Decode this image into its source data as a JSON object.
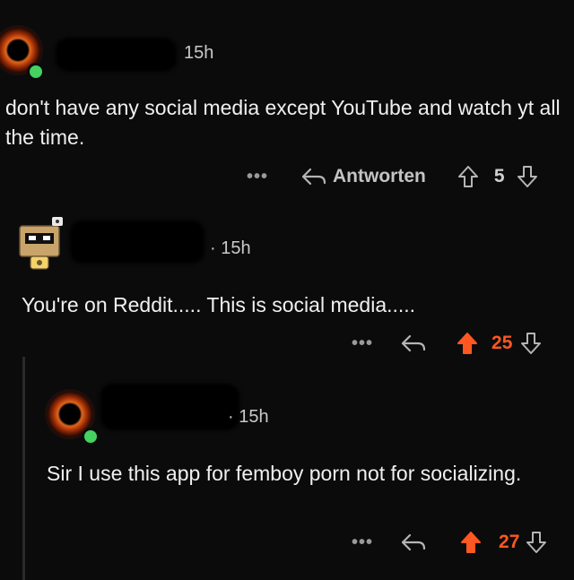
{
  "comments": [
    {
      "time": "15h",
      "text": "don't have any social media except YouTube and watch yt all the time.",
      "reply_label": "Antworten",
      "more": "•••",
      "votes": "5"
    },
    {
      "time": "· 15h",
      "text": "You're on Reddit..... This is social media.....",
      "more": "•••",
      "votes": "25"
    },
    {
      "time": "· 15h",
      "text": "Sir I use this app for femboy porn not for socializing.",
      "more": "•••",
      "votes": "27"
    }
  ],
  "colors": {
    "upvoted": "#ff5722",
    "online": "#46d160",
    "background": "#0b0b0c"
  },
  "icons": [
    "reply-arrow-icon",
    "upvote-arrow-icon",
    "downvote-arrow-icon",
    "more-options-icon"
  ]
}
